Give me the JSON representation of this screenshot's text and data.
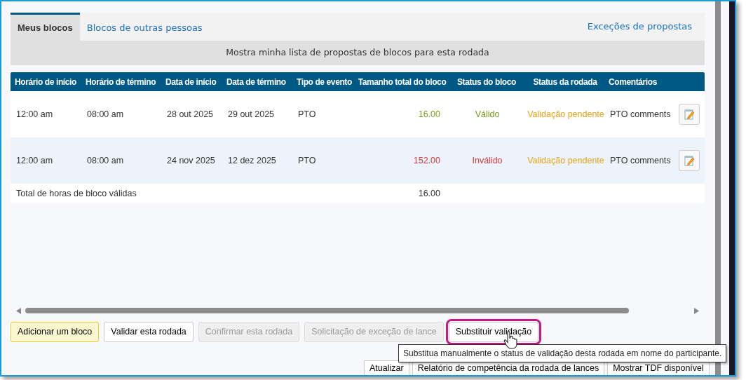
{
  "tabs": [
    {
      "label": "Meus blocos",
      "selected": true
    },
    {
      "label": "Blocos de outras pessoas",
      "selected": false
    }
  ],
  "exceptions_link": "Exceções de propostas",
  "description": "Mostra minha lista de propostas de blocos para esta rodada",
  "table": {
    "columns": [
      "Horário de início",
      "Horário de término",
      "Data de início",
      "Data de término",
      "Tipo de evento",
      "Tamanho total do bloco",
      "Status do bloco",
      "Status da rodada",
      "Comentários"
    ],
    "rows": [
      {
        "start_time": "12:00 am",
        "end_time": "08:00 am",
        "start_date": "28 out 2025",
        "end_date": "29 out 2025",
        "event_type": "PTO",
        "total_size": "16.00",
        "block_status": "Válido",
        "valid": true,
        "round_status": "Validação pendente",
        "comments": "PTO comments"
      },
      {
        "start_time": "12:00 am",
        "end_time": "08:00 am",
        "start_date": "24 nov 2025",
        "end_date": "12 dez 2025",
        "event_type": "PTO",
        "total_size": "152.00",
        "block_status": "Inválido",
        "valid": false,
        "round_status": "Validação pendente",
        "comments": "PTO comments"
      }
    ],
    "total": {
      "label": "Total de horas de bloco válidas",
      "value": "16.00"
    }
  },
  "buttons": [
    {
      "label": "Adicionar um bloco",
      "kind": "primary",
      "disabled": false,
      "highlighted": false
    },
    {
      "label": "Validar esta rodada",
      "kind": "default",
      "disabled": false,
      "highlighted": false
    },
    {
      "label": "Confirmar esta rodada",
      "kind": "default",
      "disabled": true,
      "highlighted": false
    },
    {
      "label": "Solicitação de exceção de lance",
      "kind": "default",
      "disabled": true,
      "highlighted": false
    },
    {
      "label": "Substituir validação",
      "kind": "default",
      "disabled": false,
      "highlighted": true
    }
  ],
  "tooltip": "Substitua manualmente o status de validação desta rodada em nome do participante.",
  "footer_buttons": [
    "Atualizar",
    "Relatório de competência da rodada de lances",
    "Mostrar TDF disponível"
  ]
}
